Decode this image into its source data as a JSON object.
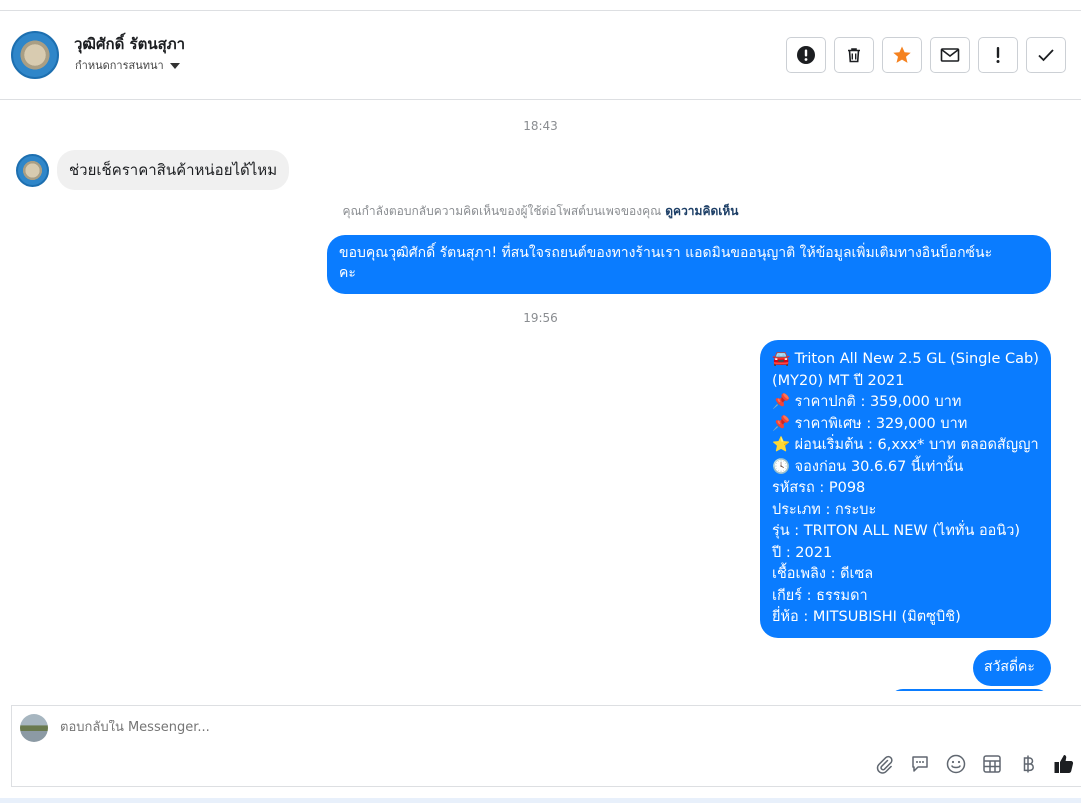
{
  "header": {
    "contact_name": "วุฒิศักดิ์ รัตนสุภา",
    "assign_label": "กำหนดการสนทนา",
    "actions": [
      {
        "icon": "alert-circle-icon",
        "name": "report-button"
      },
      {
        "icon": "trash-icon",
        "name": "delete-button"
      },
      {
        "icon": "star-icon",
        "name": "star-button"
      },
      {
        "icon": "envelope-icon",
        "name": "mark-unread-button"
      },
      {
        "icon": "exclamation-icon",
        "name": "spam-button"
      },
      {
        "icon": "check-icon",
        "name": "done-button"
      }
    ],
    "star_color": "#f5821f"
  },
  "chat": {
    "time_1": "18:43",
    "incoming_message": "ช่วยเช็คราคาสินค้าหน่อยได้ไหม",
    "reply_notice": "คุณกำลังตอบกลับความคิดเห็นของผู้ใช้ต่อโพสต์บนเพจของคุณ",
    "reply_notice_link": "ดูความคิดเห็น",
    "outgoing_1_line1": "ขอบคุณวุฒิศักดิ์ รัตนสุภา! ที่สนใจรถยนต์ของทางร้านเรา แอดมินขออนุญาติ ให้ข้อมูลเพิ่มเติมทางอินบ็อกซ์นะ",
    "outgoing_1_line2": "คะ",
    "time_2": "19:56",
    "car_lines": [
      "🚘 Triton All New 2.5 GL (Single Cab)",
      "(MY20) MT ปี 2021",
      "📌 ราคาปกติ : 359,000 บาท",
      "📌 ราคาพิเศษ : 329,000 บาท",
      "⭐ ผ่อนเริ่มต้น : 6,xxx* บาท ตลอดสัญญา",
      "🕓 จองก่อน 30.6.67 นี้เท่านั้น",
      "รหัสรถ : P098",
      "ประเภท : กระบะ",
      "รุ่น : TRITON ALL NEW (ไททั่น ออนิว)",
      "ปี : 2021",
      "เชื้อเพลิง : ดีเซล",
      "เกียร์ : ธรรมดา",
      "ยี่ห้อ : MITSUBISHI (มิตซูบิชิ)"
    ],
    "greeting": "สวัสดี่คะ",
    "bubble_color": "#0a7cff"
  },
  "composer": {
    "placeholder": "ตอบกลับใน Messenger...",
    "tools": [
      "paperclip-icon",
      "speech-bubble-icon",
      "smiley-icon",
      "grid-icon",
      "baht-icon",
      "thumbs-up-icon"
    ]
  }
}
